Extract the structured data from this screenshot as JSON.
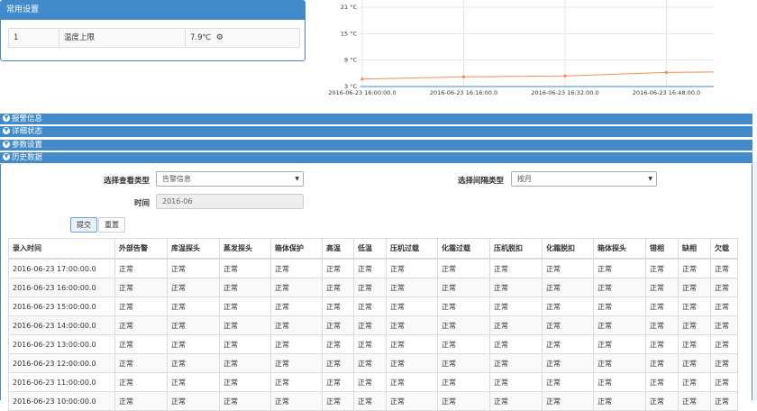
{
  "settings": {
    "title": "常用设置",
    "row": {
      "index": "1",
      "name": "温度上限",
      "value": "7.9℃"
    }
  },
  "chart_data": {
    "type": "line",
    "x": [
      "2016-06-23 16:00:00.0",
      "2016-06-23 16:16:00.0",
      "2016-06-23 16:32:00.0",
      "2016-06-23 16:48:00.0"
    ],
    "y_tick_labels": [
      "21 °C",
      "15 °C",
      "9 °C",
      "3 °C"
    ],
    "ylim": [
      3,
      21
    ],
    "series": [
      {
        "values": [
          4.7,
          5.2,
          5.4,
          6.2
        ],
        "color": "#f58a4c"
      }
    ],
    "grid": true
  },
  "sections": [
    {
      "label": "报警信息"
    },
    {
      "label": "详细状态"
    },
    {
      "label": "参数设置"
    },
    {
      "label": "历史数据"
    }
  ],
  "form": {
    "view_type_label": "选择查看类型",
    "view_type_value": "告警信息",
    "interval_label": "选择间隔类型",
    "interval_value": "按月",
    "time_label": "时间",
    "time_value": "2016-06",
    "submit": "提交",
    "reset": "重置"
  },
  "table": {
    "headers": [
      "录入时间",
      "外部告警",
      "库温探头",
      "蒸发探头",
      "箱体保护",
      "高温",
      "低温",
      "压机过载",
      "化霜过载",
      "压机脱扣",
      "化霜脱扣",
      "箱体探头",
      "错相",
      "缺相",
      "欠载"
    ],
    "rows": [
      [
        "2016-06-23 17:00:00.0",
        "正常",
        "正常",
        "正常",
        "正常",
        "正常",
        "正常",
        "正常",
        "正常",
        "正常",
        "正常",
        "正常",
        "正常",
        "正常",
        "正常"
      ],
      [
        "2016-06-23 16:00:00.0",
        "正常",
        "正常",
        "正常",
        "正常",
        "正常",
        "正常",
        "正常",
        "正常",
        "正常",
        "正常",
        "正常",
        "正常",
        "正常",
        "正常"
      ],
      [
        "2016-06-23 15:00:00.0",
        "正常",
        "正常",
        "正常",
        "正常",
        "正常",
        "正常",
        "正常",
        "正常",
        "正常",
        "正常",
        "正常",
        "正常",
        "正常",
        "正常"
      ],
      [
        "2016-06-23 14:00:00.0",
        "正常",
        "正常",
        "正常",
        "正常",
        "正常",
        "正常",
        "正常",
        "正常",
        "正常",
        "正常",
        "正常",
        "正常",
        "正常",
        "正常"
      ],
      [
        "2016-06-23 13:00:00.0",
        "正常",
        "正常",
        "正常",
        "正常",
        "正常",
        "正常",
        "正常",
        "正常",
        "正常",
        "正常",
        "正常",
        "正常",
        "正常",
        "正常"
      ],
      [
        "2016-06-23 12:00:00.0",
        "正常",
        "正常",
        "正常",
        "正常",
        "正常",
        "正常",
        "正常",
        "正常",
        "正常",
        "正常",
        "正常",
        "正常",
        "正常",
        "正常"
      ],
      [
        "2016-06-23 11:00:00.0",
        "正常",
        "正常",
        "正常",
        "正常",
        "正常",
        "正常",
        "正常",
        "正常",
        "正常",
        "正常",
        "正常",
        "正常",
        "正常",
        "正常"
      ],
      [
        "2016-06-23 10:00:00.0",
        "正常",
        "正常",
        "正常",
        "正常",
        "正常",
        "正常",
        "正常",
        "正常",
        "正常",
        "正常",
        "正常",
        "正常",
        "正常",
        "正常"
      ]
    ]
  }
}
